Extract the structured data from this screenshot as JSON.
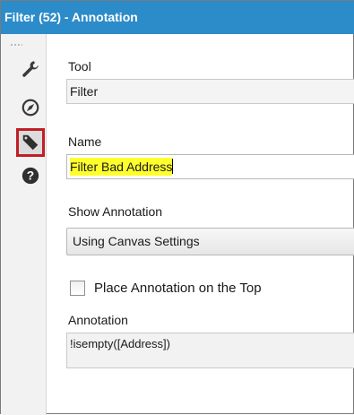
{
  "window": {
    "title": "Filter (52) - Annotation"
  },
  "rail": {
    "icons": [
      "wrench-icon",
      "compass-icon",
      "tag-icon",
      "help-icon"
    ],
    "selected": "tag-icon",
    "selected_color": "#c11e24"
  },
  "tool": {
    "label": "Tool",
    "value": "Filter"
  },
  "name": {
    "label": "Name",
    "value": "Filter Bad Address",
    "highlight_color": "#ffff2e"
  },
  "show_annotation": {
    "label": "Show Annotation",
    "selected": "Using Canvas Settings"
  },
  "place_on_top": {
    "label": "Place Annotation on the Top",
    "checked": false
  },
  "annotation": {
    "label": "Annotation",
    "value": "!isempty([Address])"
  },
  "colors": {
    "titlebar": "#2c8bc9"
  }
}
